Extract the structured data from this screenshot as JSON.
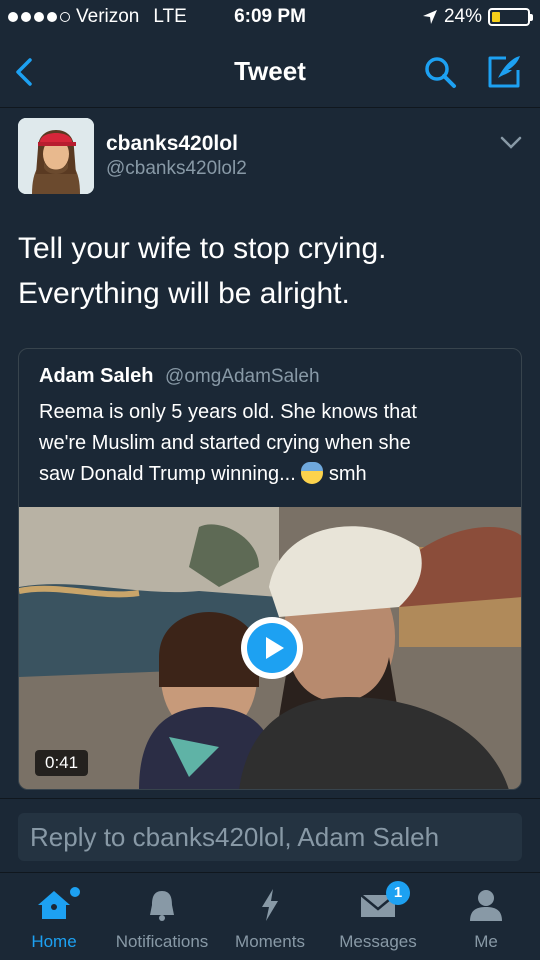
{
  "status_bar": {
    "carrier": "Verizon",
    "network": "LTE",
    "time": "6:09 PM",
    "battery_percent": "24%",
    "battery_level": 0.24,
    "signal_bars_filled": 4
  },
  "nav": {
    "title": "Tweet",
    "back_icon": "chevron-left-icon",
    "search_icon": "search-icon",
    "compose_icon": "compose-icon",
    "accent_color": "#1da1f2"
  },
  "tweet": {
    "author_name": "cbanks420lol",
    "author_handle": "@cbanks420lol2",
    "text_line1": "Tell your wife to stop crying.",
    "text_line2": "Everything will be alright.",
    "quoted": {
      "name": "Adam Saleh",
      "handle": "@omgAdamSaleh",
      "text_line1": "Reema is only 5 years old. She knows that",
      "text_line2": "we're Muslim and started crying when she",
      "text_line3_before": "saw Donald Trump winning... ",
      "text_line3_after": " smh",
      "emoji": "fearful-face-emoji",
      "video_duration": "0:41"
    }
  },
  "reply": {
    "placeholder": "Reply to cbanks420lol, Adam Saleh"
  },
  "tabs": [
    {
      "label": "Home",
      "icon": "home-icon",
      "active": true
    },
    {
      "label": "Notifications",
      "icon": "bell-icon",
      "active": false
    },
    {
      "label": "Moments",
      "icon": "lightning-icon",
      "active": false
    },
    {
      "label": "Messages",
      "icon": "envelope-icon",
      "active": false,
      "badge": "1"
    },
    {
      "label": "Me",
      "icon": "person-icon",
      "active": false
    }
  ]
}
